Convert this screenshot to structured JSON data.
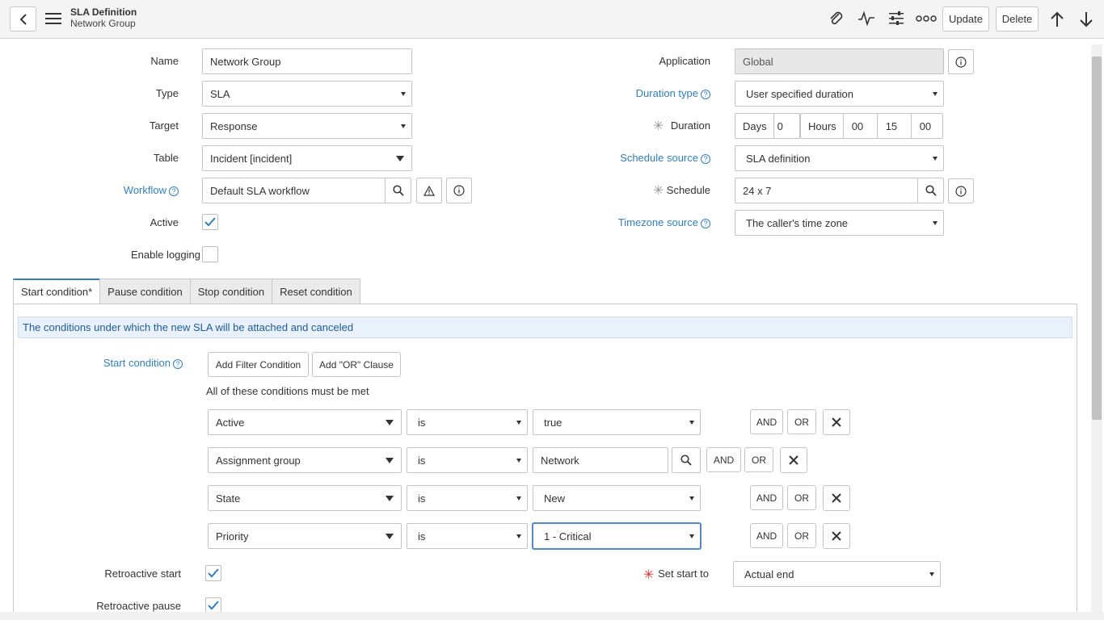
{
  "header": {
    "title": "SLA Definition",
    "subtitle": "Network Group",
    "update_label": "Update",
    "delete_label": "Delete"
  },
  "form": {
    "name": {
      "label": "Name",
      "value": "Network Group"
    },
    "type": {
      "label": "Type",
      "value": "SLA"
    },
    "target": {
      "label": "Target",
      "value": "Response"
    },
    "table": {
      "label": "Table",
      "value": "Incident [incident]"
    },
    "workflow": {
      "label": "Workflow",
      "value": "Default SLA workflow"
    },
    "active": {
      "label": "Active",
      "checked": true
    },
    "enable_logging": {
      "label": "Enable logging",
      "checked": false
    },
    "application": {
      "label": "Application",
      "value": "Global"
    },
    "duration_type": {
      "label": "Duration type",
      "value": "User specified duration"
    },
    "duration": {
      "label": "Duration",
      "days_label": "Days",
      "days": "0",
      "hours_label": "Hours",
      "hours": "00",
      "minutes": "15",
      "seconds": "00"
    },
    "schedule_source": {
      "label": "Schedule source",
      "value": "SLA definition"
    },
    "schedule": {
      "label": "Schedule",
      "value": "24 x 7"
    },
    "timezone_source": {
      "label": "Timezone source",
      "value": "The caller's time zone"
    }
  },
  "tabs": [
    "Start condition*",
    "Pause condition",
    "Stop condition",
    "Reset condition"
  ],
  "start_condition": {
    "info": "The conditions under which the new SLA will be attached and canceled",
    "label": "Start condition",
    "add_filter": "Add Filter Condition",
    "add_or": "Add \"OR\" Clause",
    "all_met": "All of these conditions must be met",
    "and_label": "AND",
    "or_label": "OR",
    "conditions": [
      {
        "field": "Active",
        "op": "is",
        "value": "true"
      },
      {
        "field": "Assignment group",
        "op": "is",
        "value": "Network"
      },
      {
        "field": "State",
        "op": "is",
        "value": "New"
      },
      {
        "field": "Priority",
        "op": "is",
        "value": "1 - Critical"
      }
    ]
  },
  "retroactive": {
    "start_label": "Retroactive start",
    "start_checked": true,
    "pause_label": "Retroactive pause",
    "pause_checked": true,
    "set_start_label": "Set start to",
    "set_start_value": "Actual end"
  }
}
